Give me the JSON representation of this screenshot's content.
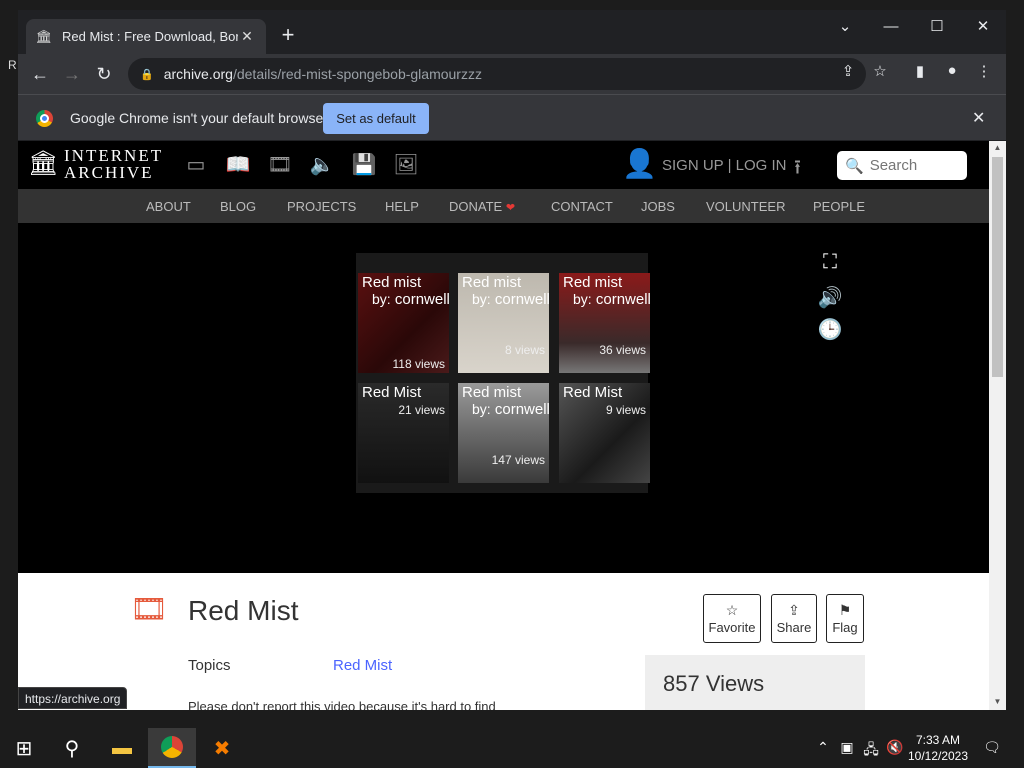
{
  "browser": {
    "tab_title": "Red Mist : Free Download, Borrow",
    "url_host": "archive.org",
    "url_path": "/details/red-mist-spongebob-glamourzzz",
    "status_url": "https://archive.org"
  },
  "infobar": {
    "message": "Google Chrome isn't your default browser",
    "button_label": "Set as default"
  },
  "ia": {
    "logo_line1": "INTERNET",
    "logo_line2": "ARCHIVE",
    "auth_text": "SIGN UP | LOG IN",
    "search_placeholder": "Search",
    "nav": [
      "ABOUT",
      "BLOG",
      "PROJECTS",
      "HELP",
      "DONATE",
      "CONTACT",
      "JOBS",
      "VOLUNTEER",
      "PEOPLE"
    ]
  },
  "related": [
    {
      "title": "Red mist",
      "by": "by:",
      "creator": "cornwell patricia daniels. author",
      "views": "118 views"
    },
    {
      "title": "Red mist",
      "by": "by:",
      "creator": "cornwell patricia daniels",
      "views": "8 views"
    },
    {
      "title": "Red mist",
      "by": "by:",
      "creator": "cornwell patricia daniels",
      "views": "36 views"
    },
    {
      "title": "Red Mist",
      "views": "21 views"
    },
    {
      "title": "Red mist",
      "by": "by:",
      "creator": "cornwell patricia daniels",
      "views": "147 views"
    },
    {
      "title": "Red Mist",
      "views": "9 views"
    }
  ],
  "item": {
    "title": "Red Mist",
    "buttons": {
      "favorite": "Favorite",
      "share": "Share",
      "flag": "Flag"
    },
    "topics_label": "Topics",
    "topics_value": "Red Mist",
    "views": "857 Views",
    "description": "Please don't report this video because it's hard to find"
  },
  "taskbar": {
    "time": "7:33 AM",
    "date": "10/12/2023"
  }
}
